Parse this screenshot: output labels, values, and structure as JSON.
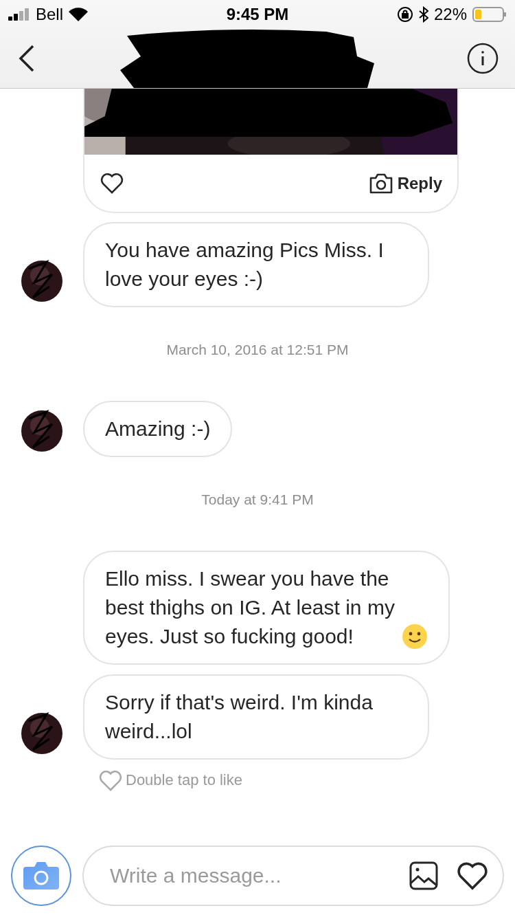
{
  "status_bar": {
    "carrier": "Bell",
    "time": "9:45 PM",
    "battery": "22%"
  },
  "shared_post": {
    "reply_label": "Reply"
  },
  "messages": [
    {
      "kind": "message",
      "text": "You have amazing Pics Miss. I love your eyes :-)",
      "avatar": true,
      "emoji": false
    },
    {
      "kind": "timestamp",
      "text": "March 10, 2016 at 12:51 PM"
    },
    {
      "kind": "message",
      "text": "Amazing :-)",
      "avatar": true,
      "emoji": false
    },
    {
      "kind": "timestamp",
      "text": "Today at 9:41 PM"
    },
    {
      "kind": "message",
      "text": "Ello miss. I swear you have the best thighs on IG. At least in my eyes. Just so fucking good!",
      "avatar": false,
      "emoji": true
    },
    {
      "kind": "message",
      "text": "Sorry if that's weird. I'm kinda weird...lol",
      "avatar": true,
      "emoji": false
    }
  ],
  "like_hint": "Double tap to like",
  "composer": {
    "placeholder": "Write a message..."
  }
}
